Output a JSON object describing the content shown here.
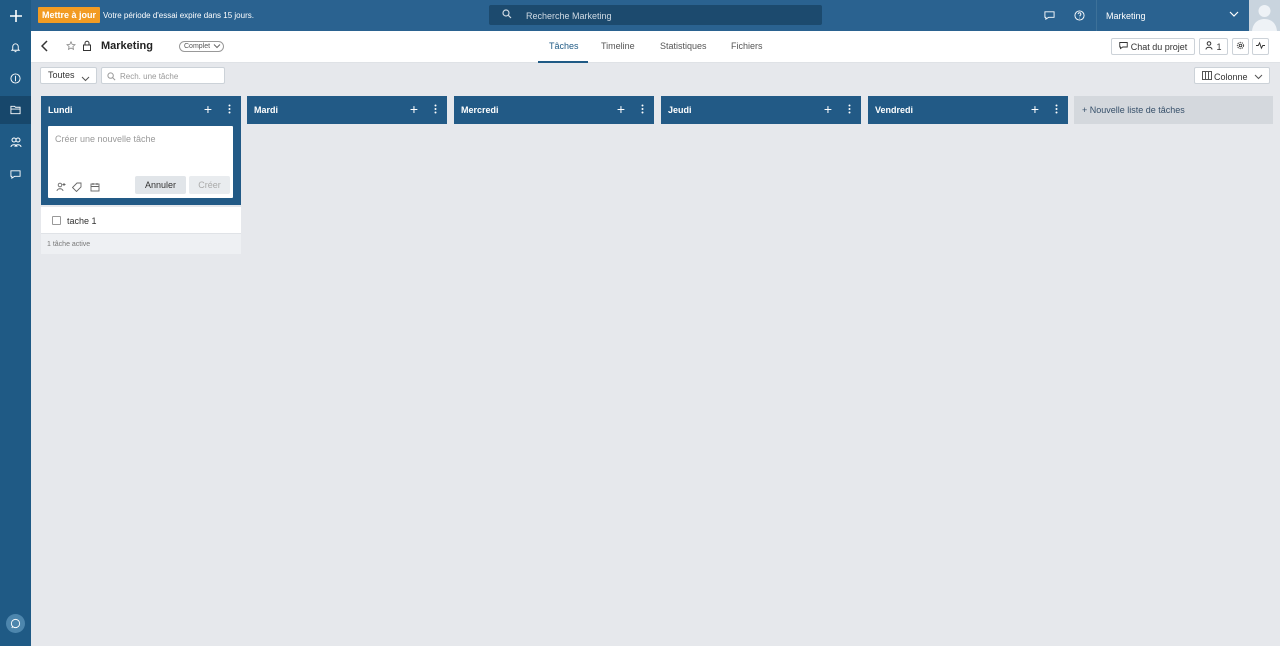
{
  "topbar": {
    "upgrade_label": "Mettre à jour",
    "trial_text": "Votre période d'essai expire dans 15 jours.",
    "search_placeholder": "Recherche Marketing",
    "workspace": "Marketing"
  },
  "rail": {
    "icons": [
      "plus-icon",
      "bell-icon",
      "pulse-icon",
      "folder-icon",
      "people-icon",
      "chat-icon",
      "support-icon"
    ]
  },
  "project": {
    "title": "Marketing",
    "status": "Complet",
    "tabs": [
      {
        "label": "Tâches",
        "active": true
      },
      {
        "label": "Timeline",
        "active": false
      },
      {
        "label": "Statistiques",
        "active": false
      },
      {
        "label": "Fichiers",
        "active": false
      }
    ],
    "chat_label": "Chat du projet",
    "members_count": "1"
  },
  "filters": {
    "scope": "Toutes",
    "search_placeholder": "Rech. une tâche",
    "view": "Colonne"
  },
  "columns": [
    {
      "name": "Lundi"
    },
    {
      "name": "Mardi"
    },
    {
      "name": "Mercredi"
    },
    {
      "name": "Jeudi"
    },
    {
      "name": "Vendredi"
    }
  ],
  "new_task": {
    "placeholder": "Créer une nouvelle tâche",
    "cancel_label": "Annuler",
    "create_label": "Créer"
  },
  "tasks": [
    {
      "name": "tache 1",
      "done": false
    }
  ],
  "column_footer": "1 tâche active",
  "new_list_label": "+ Nouvelle liste de tâches",
  "colors": {
    "primary": "#225a86",
    "topbar": "#2a6290",
    "upgrade": "#f29b22",
    "background": "#e6e8ec"
  }
}
